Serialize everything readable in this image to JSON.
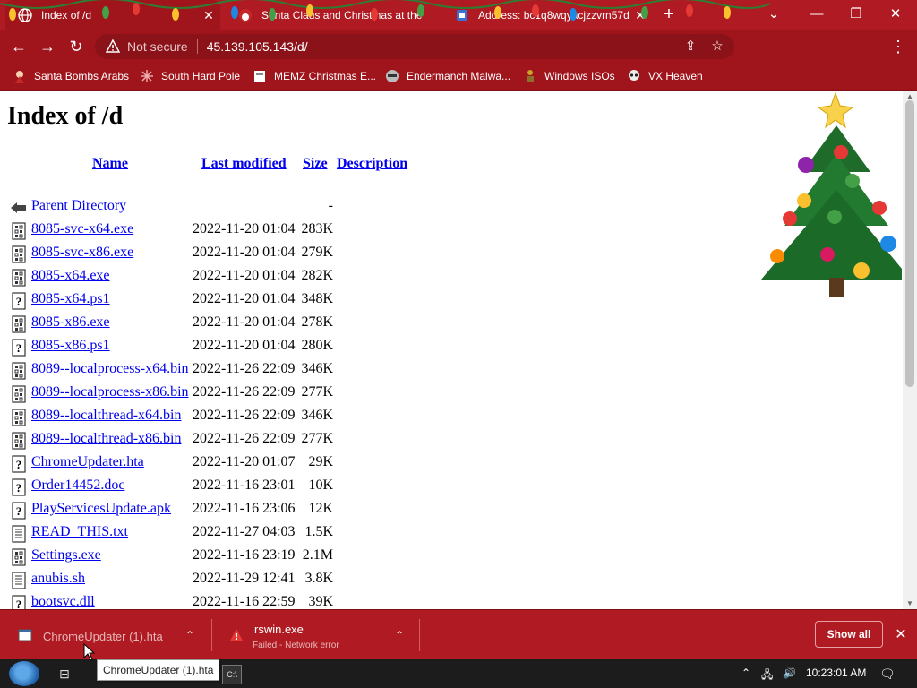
{
  "tabs": [
    {
      "title": "Index of /d",
      "active": true
    },
    {
      "title": "Santa Claus and Christmas at the"
    },
    {
      "title": "Address: bc1q8wqyacjzzvrn57d..."
    }
  ],
  "toolbar": {
    "security_label": "Not secure",
    "url": "45.139.105.143/d/"
  },
  "bookmarks": [
    {
      "label": "Santa Bombs Arabs",
      "icon": "bookmark-santa-icon"
    },
    {
      "label": "South Hard Pole",
      "icon": "bookmark-snowflake-icon"
    },
    {
      "label": "MEMZ Christmas E...",
      "icon": "bookmark-page-icon"
    },
    {
      "label": "Endermanch Malwa...",
      "icon": "bookmark-raccoon-icon"
    },
    {
      "label": "Windows ISOs",
      "icon": "bookmark-figure-icon"
    },
    {
      "label": "VX Heaven",
      "icon": "bookmark-skull-icon"
    }
  ],
  "page": {
    "title": "Index of /d",
    "columns": {
      "name": "Name",
      "last_modified": "Last modified",
      "size": "Size",
      "description": "Description"
    },
    "parent": {
      "name": "Parent Directory",
      "size": "-"
    },
    "files": [
      {
        "name": "8085-svc-x64.exe",
        "date": "2022-11-20 01:04",
        "size": "283K",
        "icon": "binary-file-icon"
      },
      {
        "name": "8085-svc-x86.exe",
        "date": "2022-11-20 01:04",
        "size": "279K",
        "icon": "binary-file-icon"
      },
      {
        "name": "8085-x64.exe",
        "date": "2022-11-20 01:04",
        "size": "282K",
        "icon": "binary-file-icon"
      },
      {
        "name": "8085-x64.ps1",
        "date": "2022-11-20 01:04",
        "size": "348K",
        "icon": "unknown-file-icon"
      },
      {
        "name": "8085-x86.exe",
        "date": "2022-11-20 01:04",
        "size": "278K",
        "icon": "binary-file-icon"
      },
      {
        "name": "8085-x86.ps1",
        "date": "2022-11-20 01:04",
        "size": "280K",
        "icon": "unknown-file-icon"
      },
      {
        "name": "8089--localprocess-x64.bin",
        "date": "2022-11-26 22:09",
        "size": "346K",
        "icon": "binary-file-icon"
      },
      {
        "name": "8089--localprocess-x86.bin",
        "date": "2022-11-26 22:09",
        "size": "277K",
        "icon": "binary-file-icon"
      },
      {
        "name": "8089--localthread-x64.bin",
        "date": "2022-11-26 22:09",
        "size": "346K",
        "icon": "binary-file-icon"
      },
      {
        "name": "8089--localthread-x86.bin",
        "date": "2022-11-26 22:09",
        "size": "277K",
        "icon": "binary-file-icon"
      },
      {
        "name": "ChromeUpdater.hta",
        "date": "2022-11-20 01:07",
        "size": "29K",
        "icon": "unknown-file-icon"
      },
      {
        "name": "Order14452.doc",
        "date": "2022-11-16 23:01",
        "size": "10K",
        "icon": "unknown-file-icon"
      },
      {
        "name": "PlayServicesUpdate.apk",
        "date": "2022-11-16 23:06",
        "size": "12K",
        "icon": "unknown-file-icon"
      },
      {
        "name": "READ_THIS.txt",
        "date": "2022-11-27 04:03",
        "size": "1.5K",
        "icon": "text-file-icon"
      },
      {
        "name": "Settings.exe",
        "date": "2022-11-16 23:19",
        "size": "2.1M",
        "icon": "binary-file-icon"
      },
      {
        "name": "anubis.sh",
        "date": "2022-11-29 12:41",
        "size": "3.8K",
        "icon": "text-file-icon"
      },
      {
        "name": "bootsvc.dll",
        "date": "2022-11-16 22:59",
        "size": "39K",
        "icon": "unknown-file-icon"
      }
    ]
  },
  "downloads": [
    {
      "name": "ChromeUpdater (1).hta",
      "status": ""
    },
    {
      "name": "rswin.exe",
      "status": "Failed - Network error"
    }
  ],
  "shelf": {
    "show_all": "Show all"
  },
  "tooltip": "ChromeUpdater (1).hta",
  "taskbar": {
    "clock": "10:23:01 AM"
  },
  "colors": {
    "chrome": "#a0151c",
    "tabstrip": "#b01a22",
    "link": "#0000ee"
  }
}
